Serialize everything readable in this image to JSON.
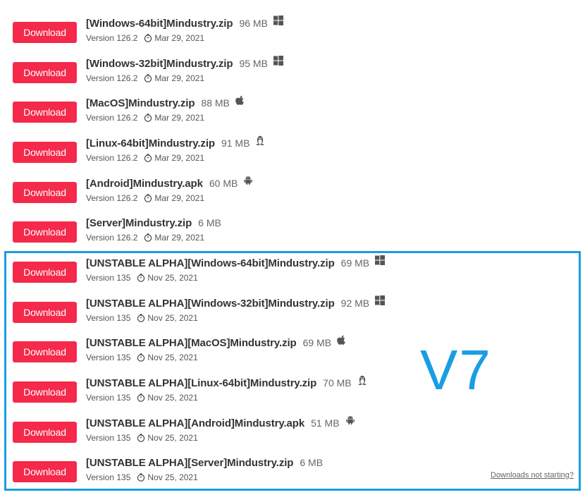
{
  "download_label": "Download",
  "downloads": [
    {
      "name": "[Windows-64bit]Mindustry.zip",
      "size": "96 MB",
      "os": "windows",
      "version": "Version 126.2",
      "date": "Mar 29, 2021"
    },
    {
      "name": "[Windows-32bit]Mindustry.zip",
      "size": "95 MB",
      "os": "windows",
      "version": "Version 126.2",
      "date": "Mar 29, 2021"
    },
    {
      "name": "[MacOS]Mindustry.zip",
      "size": "88 MB",
      "os": "apple",
      "version": "Version 126.2",
      "date": "Mar 29, 2021"
    },
    {
      "name": "[Linux-64bit]Mindustry.zip",
      "size": "91 MB",
      "os": "linux",
      "version": "Version 126.2",
      "date": "Mar 29, 2021"
    },
    {
      "name": "[Android]Mindustry.apk",
      "size": "60 MB",
      "os": "android",
      "version": "Version 126.2",
      "date": "Mar 29, 2021"
    },
    {
      "name": "[Server]Mindustry.zip",
      "size": "6 MB",
      "os": "",
      "version": "Version 126.2",
      "date": "Mar 29, 2021"
    },
    {
      "name": "[UNSTABLE ALPHA][Windows-64bit]Mindustry.zip",
      "size": "69 MB",
      "os": "windows",
      "version": "Version 135",
      "date": "Nov 25, 2021"
    },
    {
      "name": "[UNSTABLE ALPHA][Windows-32bit]Mindustry.zip",
      "size": "92 MB",
      "os": "windows",
      "version": "Version 135",
      "date": "Nov 25, 2021"
    },
    {
      "name": "[UNSTABLE ALPHA][MacOS]Mindustry.zip",
      "size": "69 MB",
      "os": "apple",
      "version": "Version 135",
      "date": "Nov 25, 2021"
    },
    {
      "name": "[UNSTABLE ALPHA][Linux-64bit]Mindustry.zip",
      "size": "70 MB",
      "os": "linux",
      "version": "Version 135",
      "date": "Nov 25, 2021"
    },
    {
      "name": "[UNSTABLE ALPHA][Android]Mindustry.apk",
      "size": "51 MB",
      "os": "android",
      "version": "Version 135",
      "date": "Nov 25, 2021"
    },
    {
      "name": "[UNSTABLE ALPHA][Server]Mindustry.zip",
      "size": "6 MB",
      "os": "",
      "version": "Version 135",
      "date": "Nov 25, 2021"
    }
  ],
  "annotation": {
    "label": "V7",
    "color": "#1a9ee2"
  },
  "footer": {
    "not_starting": "Downloads not starting?"
  },
  "colors": {
    "button": "#f5294a",
    "highlight": "#1a9ee2"
  }
}
